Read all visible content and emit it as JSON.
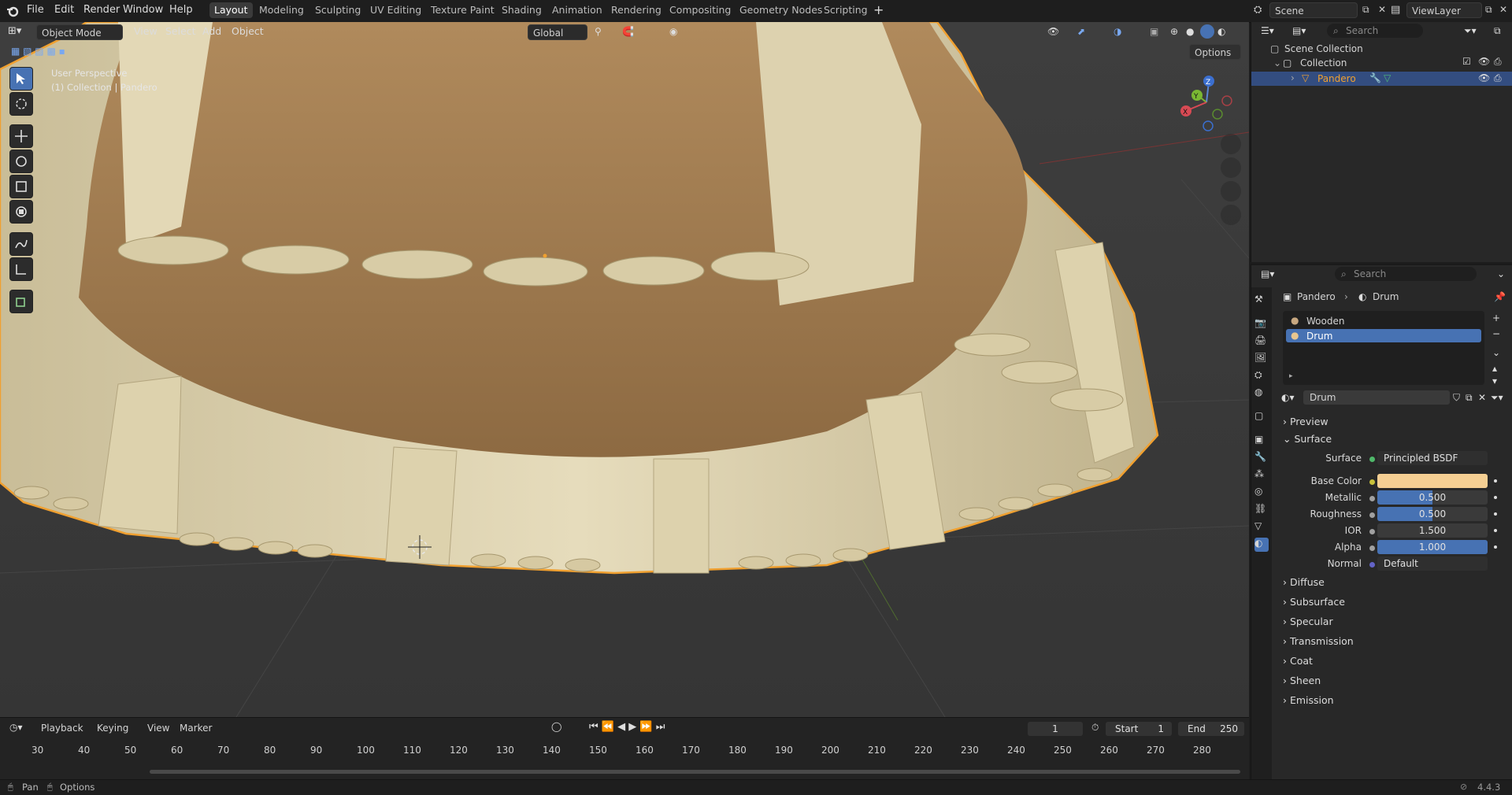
{
  "menu": {
    "file": "File",
    "edit": "Edit",
    "render": "Render",
    "window": "Window",
    "help": "Help"
  },
  "workspaces": [
    "Layout",
    "Modeling",
    "Sculpting",
    "UV Editing",
    "Texture Paint",
    "Shading",
    "Animation",
    "Rendering",
    "Compositing",
    "Geometry Nodes",
    "Scripting"
  ],
  "scene": {
    "scene_name": "Scene",
    "view_layer": "ViewLayer"
  },
  "viewport": {
    "mode": "Object Mode",
    "menus": [
      "View",
      "Select",
      "Add",
      "Object"
    ],
    "orientation": "Global",
    "options": "Options",
    "overlay_line1": "User Perspective",
    "overlay_line2": "(1) Collection | Pandero",
    "axis_x": "X",
    "axis_y": "Y",
    "axis_z": "Z"
  },
  "outliner": {
    "search_placeholder": "Search",
    "scene_collection": "Scene Collection",
    "collection": "Collection",
    "object": "Pandero"
  },
  "properties": {
    "search_placeholder": "Search",
    "breadcrumb_object": "Pandero",
    "breadcrumb_material": "Drum",
    "slots": [
      "Wooden",
      "Drum"
    ],
    "material_name": "Drum",
    "preview": "Preview",
    "surface": "Surface",
    "surface_label": "Surface",
    "surface_value": "Principled BSDF",
    "base_color_label": "Base Color",
    "base_color": "#f5cf93",
    "metallic_label": "Metallic",
    "metallic": "0.500",
    "roughness_label": "Roughness",
    "roughness": "0.500",
    "ior_label": "IOR",
    "ior": "1.500",
    "alpha_label": "Alpha",
    "alpha": "1.000",
    "normal_label": "Normal",
    "normal": "Default",
    "subpanels": [
      "Diffuse",
      "Subsurface",
      "Specular",
      "Transmission",
      "Coat",
      "Sheen",
      "Emission"
    ]
  },
  "timeline": {
    "menus": [
      "Playback",
      "Keying",
      "View",
      "Marker"
    ],
    "current_frame": "1",
    "start_label": "Start",
    "start": "1",
    "end_label": "End",
    "end": "250",
    "ticks": [
      "30",
      "40",
      "50",
      "60",
      "70",
      "80",
      "90",
      "100",
      "110",
      "120",
      "130",
      "140",
      "150",
      "160",
      "170",
      "180",
      "190",
      "200",
      "210",
      "220",
      "230",
      "240",
      "250",
      "260",
      "270",
      "280"
    ]
  },
  "status": {
    "pan": "Pan",
    "options": "Options",
    "version": "4.4.3"
  }
}
